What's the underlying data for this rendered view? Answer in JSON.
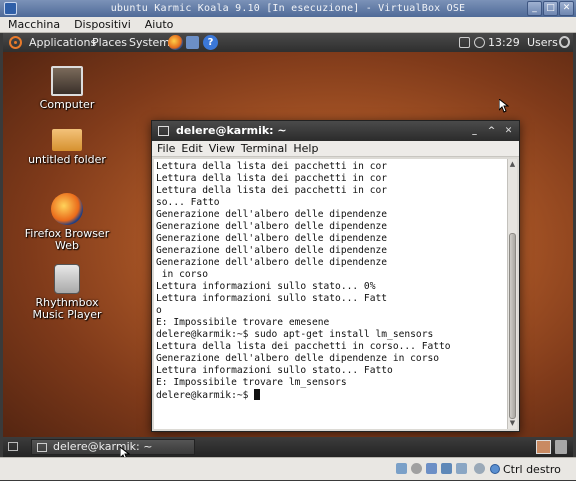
{
  "host_window": {
    "title": "ubuntu Karmic Koala 9.10 [In esecuzione] - VirtualBox OSE",
    "menu": [
      "Macchina",
      "Dispositivi",
      "Aiuto"
    ],
    "status_host_key": "Ctrl destro"
  },
  "top_panel": {
    "menus": [
      "Applications",
      "Places",
      "System"
    ],
    "clock": "13:29",
    "user": "Users"
  },
  "desktop_icons": [
    {
      "label": "Computer",
      "icon": "computer-icon"
    },
    {
      "label": "untitled folder",
      "icon": "folder-icon"
    },
    {
      "label": "Firefox Browser Web",
      "icon": "firefox-icon"
    },
    {
      "label": "Rhythmbox Music Player",
      "icon": "rhythmbox-icon"
    }
  ],
  "terminal": {
    "title": "delere@karmik: ~",
    "menu": [
      "File",
      "Edit",
      "View",
      "Terminal",
      "Help"
    ],
    "lines": [
      "Lettura della lista dei pacchetti in cor",
      "Lettura della lista dei pacchetti in cor",
      "Lettura della lista dei pacchetti in cor",
      "so... Fatto",
      "Generazione dell'albero delle dipendenze",
      "Generazione dell'albero delle dipendenze",
      "Generazione dell'albero delle dipendenze",
      "Generazione dell'albero delle dipendenze",
      "Generazione dell'albero delle dipendenze",
      " in corso",
      "Lettura informazioni sullo stato... 0%",
      "Lettura informazioni sullo stato... Fatt",
      "o",
      "E: Impossibile trovare emesene",
      "delere@karmik:~$ sudo apt-get install lm_sensors",
      "Lettura della lista dei pacchetti in corso... Fatto",
      "Generazione dell'albero delle dipendenze in corso",
      "Lettura informazioni sullo stato... Fatto",
      "E: Impossibile trovare lm_sensors"
    ],
    "prompt": "delere@karmik:~$ "
  },
  "bottom_panel": {
    "task": "delere@karmik: ~"
  },
  "colors": {
    "wallpaper": "#b25c29",
    "panel": "#2f2f2f",
    "ubuntu_orange": "#e87a2b"
  }
}
